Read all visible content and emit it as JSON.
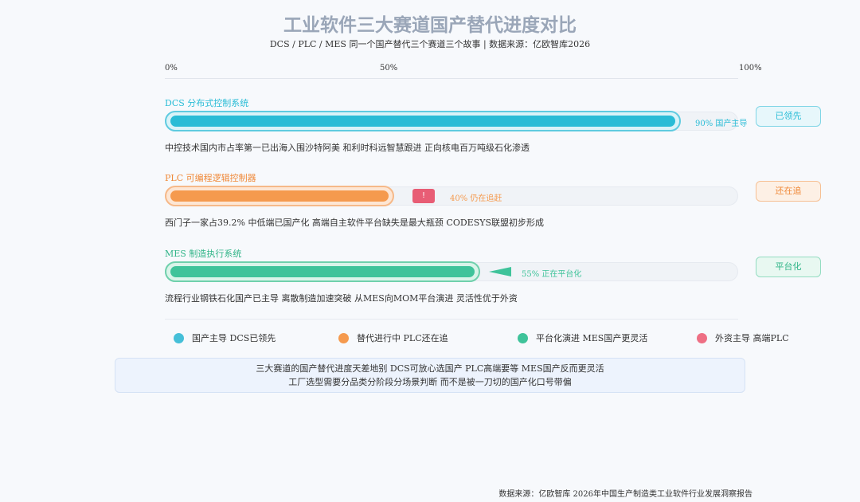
{
  "title": "工业软件三大赛道国产替代进度对比",
  "subtitle": "DCS / PLC / MES 同一个国产替代三个赛道三个故事 | 数据来源：亿欧智库2026",
  "axis_ticks": [
    "0%",
    "50%",
    "100%"
  ],
  "chart_data": {
    "type": "bar",
    "orientation": "horizontal",
    "xlim": [
      0,
      100
    ],
    "categories": [
      "DCS 分布式控制系统",
      "PLC 可编程逻辑控制器",
      "MES 制造执行系统"
    ],
    "values": [
      90,
      40,
      55
    ],
    "bar_notes": [
      "90% 国产主导",
      "40% 仍在追赶",
      "55% 正在平台化"
    ],
    "badges": [
      "已领先",
      "还在追",
      "平台化"
    ],
    "descriptions": [
      "中控技术国内市占率第一已出海入围沙特阿美 和利时科远智慧跟进 正向核电百万吨级石化渗透",
      "西门子一家占39.2% 中低端已国产化 高端自主软件平台缺失是最大瓶颈 CODESYS联盟初步形成",
      "流程行业钢铁石化国产已主导 离散制造加速突破 从MES向MOM平台演进 灵活性优于外资"
    ],
    "colors": [
      "#29bcd6",
      "#f59a4e",
      "#3fc39a"
    ]
  },
  "warning_mark": "!",
  "legend": [
    {
      "label": "国产主导 DCS已领先",
      "color": "#45bfd8"
    },
    {
      "label": "替代进行中 PLC还在追",
      "color": "#f59a4e"
    },
    {
      "label": "平台化演进 MES国产更灵活",
      "color": "#3fc39a"
    },
    {
      "label": "外资主导 高端PLC",
      "color": "#ee6f84"
    }
  ],
  "summary": {
    "line1": "三大赛道的国产替代进度天差地别 DCS可放心选国产 PLC高端要等 MES国产反而更灵活",
    "line2": "工厂选型需要分品类分阶段分场景判断 而不是被一刀切的国产化口号带偏"
  },
  "footer": "数据来源：亿欧智库 2026年中国生产制造类工业软件行业发展洞察报告"
}
